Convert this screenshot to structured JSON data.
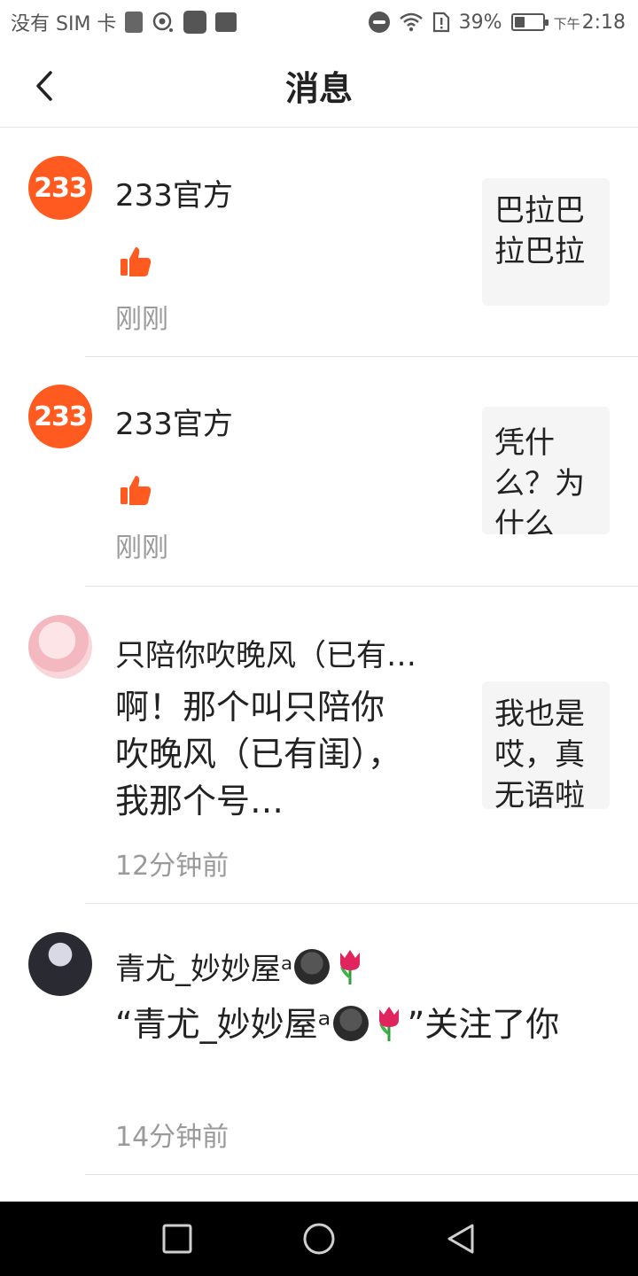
{
  "status_bar": {
    "carrier": "没有 SIM 卡",
    "battery_text": "39%",
    "battery_level": 0.39,
    "ampm": "下午",
    "time": "2:18"
  },
  "header": {
    "title": "消息"
  },
  "messages": [
    {
      "sender": "233官方",
      "avatar_text": "233",
      "content_type": "like",
      "time": "刚刚",
      "preview": "巴拉巴拉巴拉"
    },
    {
      "sender": "233官方",
      "avatar_text": "233",
      "content_type": "like",
      "time": "刚刚",
      "preview": "凭什么？为什么"
    },
    {
      "sender": "只陪你吹晚风（已有…",
      "content": "啊！那个叫只陪你吹晚风（已有闺），我那个号…",
      "time": "12分钟前",
      "preview": "我也是哎，真无语啦"
    },
    {
      "sender": "青尤_妙妙屋ᵃ",
      "content_prefix": "“青尤_妙妙屋ᵃ",
      "content_suffix": "”关注了你",
      "time": "14分钟前"
    }
  ],
  "colors": {
    "accent": "#ff5a1f",
    "muted_text": "#9a9a9a",
    "divider": "#e6e6e6"
  }
}
